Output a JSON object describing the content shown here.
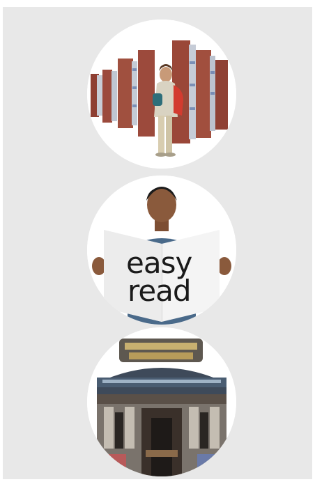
{
  "illustrations": [
    {
      "icon": "library-shelves-student-icon"
    },
    {
      "icon": "easy-read-document-icon",
      "sign": {
        "line1": "easy",
        "line2": "read"
      }
    },
    {
      "icon": "theatre-building-icon"
    }
  ],
  "colors": {
    "panel": "#e8e8e8",
    "circle": "#ffffff",
    "shelf": "#9c4a3c",
    "shirt": "#4a6a8a",
    "skin": "#8a5a3c",
    "building": "#6a6460"
  }
}
